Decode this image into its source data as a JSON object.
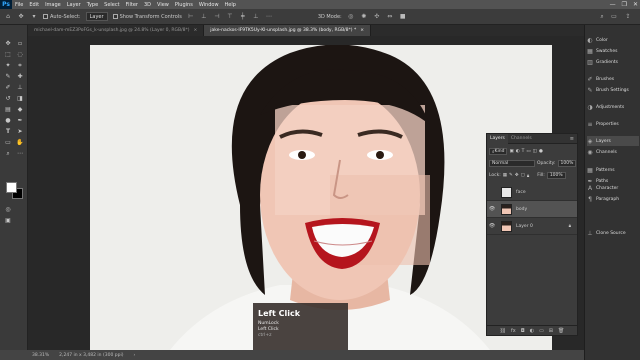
{
  "menubar": {
    "logo": "Ps",
    "items": [
      "File",
      "Edit",
      "Image",
      "Layer",
      "Type",
      "Select",
      "Filter",
      "3D",
      "View",
      "Plugins",
      "Window",
      "Help"
    ],
    "window_controls": [
      "—",
      "❐",
      "✕"
    ]
  },
  "options": {
    "auto_select_label": "Auto-Select:",
    "auto_select_value": "Layer",
    "show_transform_label": "Show Transform Controls",
    "mode_3d_label": "3D Mode:"
  },
  "tabs": [
    {
      "label": "michael-dam-mEZ3PoFGs_k-unsplash.jpg @ 24.8% (Layer 0, RGB/8*)",
      "close": "×"
    },
    {
      "label": "jake-nackos-IF9TK5Uy-KI-unsplash.jpg @ 38.3% (body, RGB/8*) *",
      "close": "×"
    }
  ],
  "status": {
    "zoom": "38.31%",
    "doc_size": "2,247 in x 3,482 in (300 ppi)"
  },
  "right_dock": {
    "items": [
      "Color",
      "Swatches",
      "Gradients",
      "Brushes",
      "Brush Settings",
      "Adjustments",
      "Properties",
      "Layers",
      "Channels",
      "Patterns",
      "Paths",
      "Character",
      "Paragraph",
      "Clone Source"
    ]
  },
  "layers_panel": {
    "tabs": [
      "Layers",
      "Channels"
    ],
    "kind_label": "Kind",
    "blend_mode": "Normal",
    "opacity_label": "Opacity:",
    "opacity_value": "100%",
    "lock_label": "Lock:",
    "fill_label": "Fill:",
    "fill_value": "100%",
    "layers": [
      {
        "name": "face",
        "visible": false,
        "selected": false
      },
      {
        "name": "body",
        "visible": true,
        "selected": true
      },
      {
        "name": "Layer 0",
        "visible": true,
        "selected": false,
        "locked": true
      }
    ],
    "bottom_icons": [
      "link-icon",
      "fx-icon",
      "mask-icon",
      "adjustment-icon",
      "group-icon",
      "new-layer-icon",
      "trash-icon"
    ]
  },
  "key_overlay": {
    "title": "Left Click",
    "line1": "NumLock",
    "line2": "Left Click",
    "line3": "ctrl+z"
  }
}
